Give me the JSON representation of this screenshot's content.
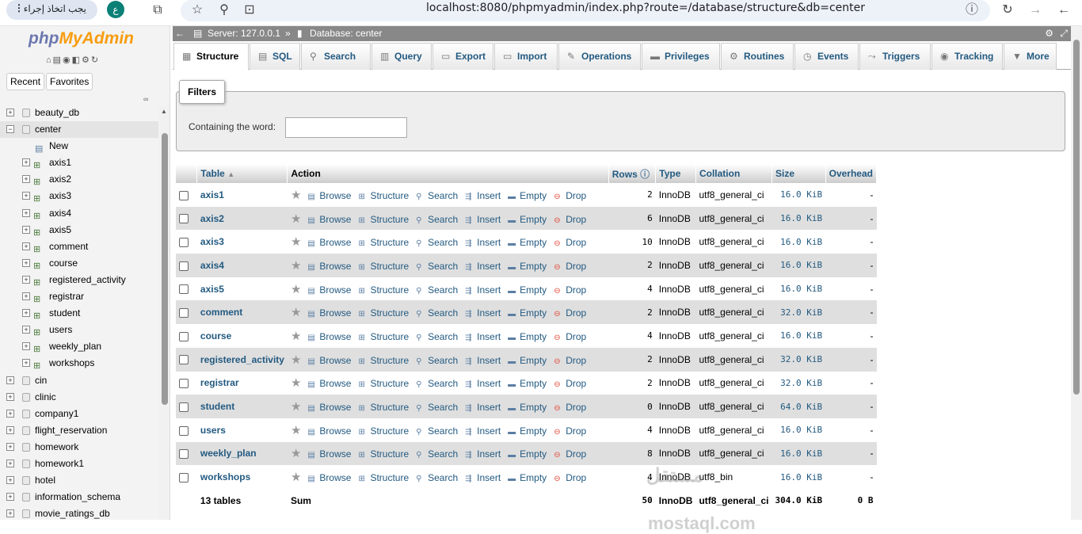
{
  "browser": {
    "action_label": "يجب اتخاذ إجراء",
    "avatar_letter": "ع",
    "url": "localhost:8080/phpmyadmin/index.php?route=/database/structure&db=center"
  },
  "sidebar": {
    "logo_php": "php",
    "logo_my": "MyAdmin",
    "tab_recent": "Recent",
    "tab_favorites": "Favorites",
    "tree": [
      {
        "label": "beauty_db",
        "level": 0,
        "kind": "db",
        "expanded": false
      },
      {
        "label": "center",
        "level": 0,
        "kind": "db",
        "expanded": true
      },
      {
        "label": "New",
        "level": 1,
        "kind": "new"
      },
      {
        "label": "axis1",
        "level": 1,
        "kind": "table"
      },
      {
        "label": "axis2",
        "level": 1,
        "kind": "table"
      },
      {
        "label": "axis3",
        "level": 1,
        "kind": "table"
      },
      {
        "label": "axis4",
        "level": 1,
        "kind": "table"
      },
      {
        "label": "axis5",
        "level": 1,
        "kind": "table"
      },
      {
        "label": "comment",
        "level": 1,
        "kind": "table"
      },
      {
        "label": "course",
        "level": 1,
        "kind": "table"
      },
      {
        "label": "registered_activity",
        "level": 1,
        "kind": "table"
      },
      {
        "label": "registrar",
        "level": 1,
        "kind": "table"
      },
      {
        "label": "student",
        "level": 1,
        "kind": "table"
      },
      {
        "label": "users",
        "level": 1,
        "kind": "table"
      },
      {
        "label": "weekly_plan",
        "level": 1,
        "kind": "table"
      },
      {
        "label": "workshops",
        "level": 1,
        "kind": "table"
      },
      {
        "label": "cin",
        "level": 0,
        "kind": "db",
        "expanded": false
      },
      {
        "label": "clinic",
        "level": 0,
        "kind": "db",
        "expanded": false
      },
      {
        "label": "company1",
        "level": 0,
        "kind": "db",
        "expanded": false
      },
      {
        "label": "flight_reservation",
        "level": 0,
        "kind": "db",
        "expanded": false
      },
      {
        "label": "homework",
        "level": 0,
        "kind": "db",
        "expanded": false
      },
      {
        "label": "homework1",
        "level": 0,
        "kind": "db",
        "expanded": false
      },
      {
        "label": "hotel",
        "level": 0,
        "kind": "db",
        "expanded": false
      },
      {
        "label": "information_schema",
        "level": 0,
        "kind": "db",
        "expanded": false
      },
      {
        "label": "movie_ratings_db",
        "level": 0,
        "kind": "db",
        "expanded": false
      }
    ]
  },
  "topbar": {
    "server": "Server: 127.0.0.1",
    "separator": "»",
    "database": "Database: center"
  },
  "tabs": [
    "Structure",
    "SQL",
    "Search",
    "Query",
    "Export",
    "Import",
    "Operations",
    "Privileges",
    "Routines",
    "Events",
    "Triggers",
    "Tracking",
    "More"
  ],
  "filters": {
    "legend": "Filters",
    "label": "Containing the word:",
    "value": ""
  },
  "table": {
    "headers": {
      "table": "Table",
      "action": "Action",
      "rows": "Rows",
      "type": "Type",
      "collation": "Collation",
      "size": "Size",
      "overhead": "Overhead"
    },
    "actions": {
      "browse": "Browse",
      "structure": "Structure",
      "search": "Search",
      "insert": "Insert",
      "empty": "Empty",
      "drop": "Drop"
    },
    "rows": [
      {
        "name": "axis1",
        "rows": "2",
        "type": "InnoDB",
        "collation": "utf8_general_ci",
        "size": "16.0 KiB",
        "overhead": "-"
      },
      {
        "name": "axis2",
        "rows": "6",
        "type": "InnoDB",
        "collation": "utf8_general_ci",
        "size": "16.0 KiB",
        "overhead": "-"
      },
      {
        "name": "axis3",
        "rows": "10",
        "type": "InnoDB",
        "collation": "utf8_general_ci",
        "size": "16.0 KiB",
        "overhead": "-"
      },
      {
        "name": "axis4",
        "rows": "2",
        "type": "InnoDB",
        "collation": "utf8_general_ci",
        "size": "16.0 KiB",
        "overhead": "-"
      },
      {
        "name": "axis5",
        "rows": "4",
        "type": "InnoDB",
        "collation": "utf8_general_ci",
        "size": "16.0 KiB",
        "overhead": "-"
      },
      {
        "name": "comment",
        "rows": "2",
        "type": "InnoDB",
        "collation": "utf8_general_ci",
        "size": "32.0 KiB",
        "overhead": "-"
      },
      {
        "name": "course",
        "rows": "4",
        "type": "InnoDB",
        "collation": "utf8_general_ci",
        "size": "16.0 KiB",
        "overhead": "-"
      },
      {
        "name": "registered_activity",
        "rows": "2",
        "type": "InnoDB",
        "collation": "utf8_general_ci",
        "size": "32.0 KiB",
        "overhead": "-"
      },
      {
        "name": "registrar",
        "rows": "2",
        "type": "InnoDB",
        "collation": "utf8_general_ci",
        "size": "32.0 KiB",
        "overhead": "-"
      },
      {
        "name": "student",
        "rows": "0",
        "type": "InnoDB",
        "collation": "utf8_general_ci",
        "size": "64.0 KiB",
        "overhead": "-"
      },
      {
        "name": "users",
        "rows": "4",
        "type": "InnoDB",
        "collation": "utf8_general_ci",
        "size": "16.0 KiB",
        "overhead": "-"
      },
      {
        "name": "weekly_plan",
        "rows": "8",
        "type": "InnoDB",
        "collation": "utf8_general_ci",
        "size": "16.0 KiB",
        "overhead": "-"
      },
      {
        "name": "workshops",
        "rows": "4",
        "type": "InnoDB",
        "collation": "utf8_bin",
        "size": "16.0 KiB",
        "overhead": "-"
      }
    ],
    "footer": {
      "count": "13 tables",
      "sum": "Sum",
      "rows": "50",
      "type": "InnoDB",
      "collation": "utf8_general_ci",
      "size": "304.0 KiB",
      "overhead": "0 B"
    }
  },
  "watermark": {
    "line1": "مستقل",
    "line2": "mostaql.com"
  }
}
